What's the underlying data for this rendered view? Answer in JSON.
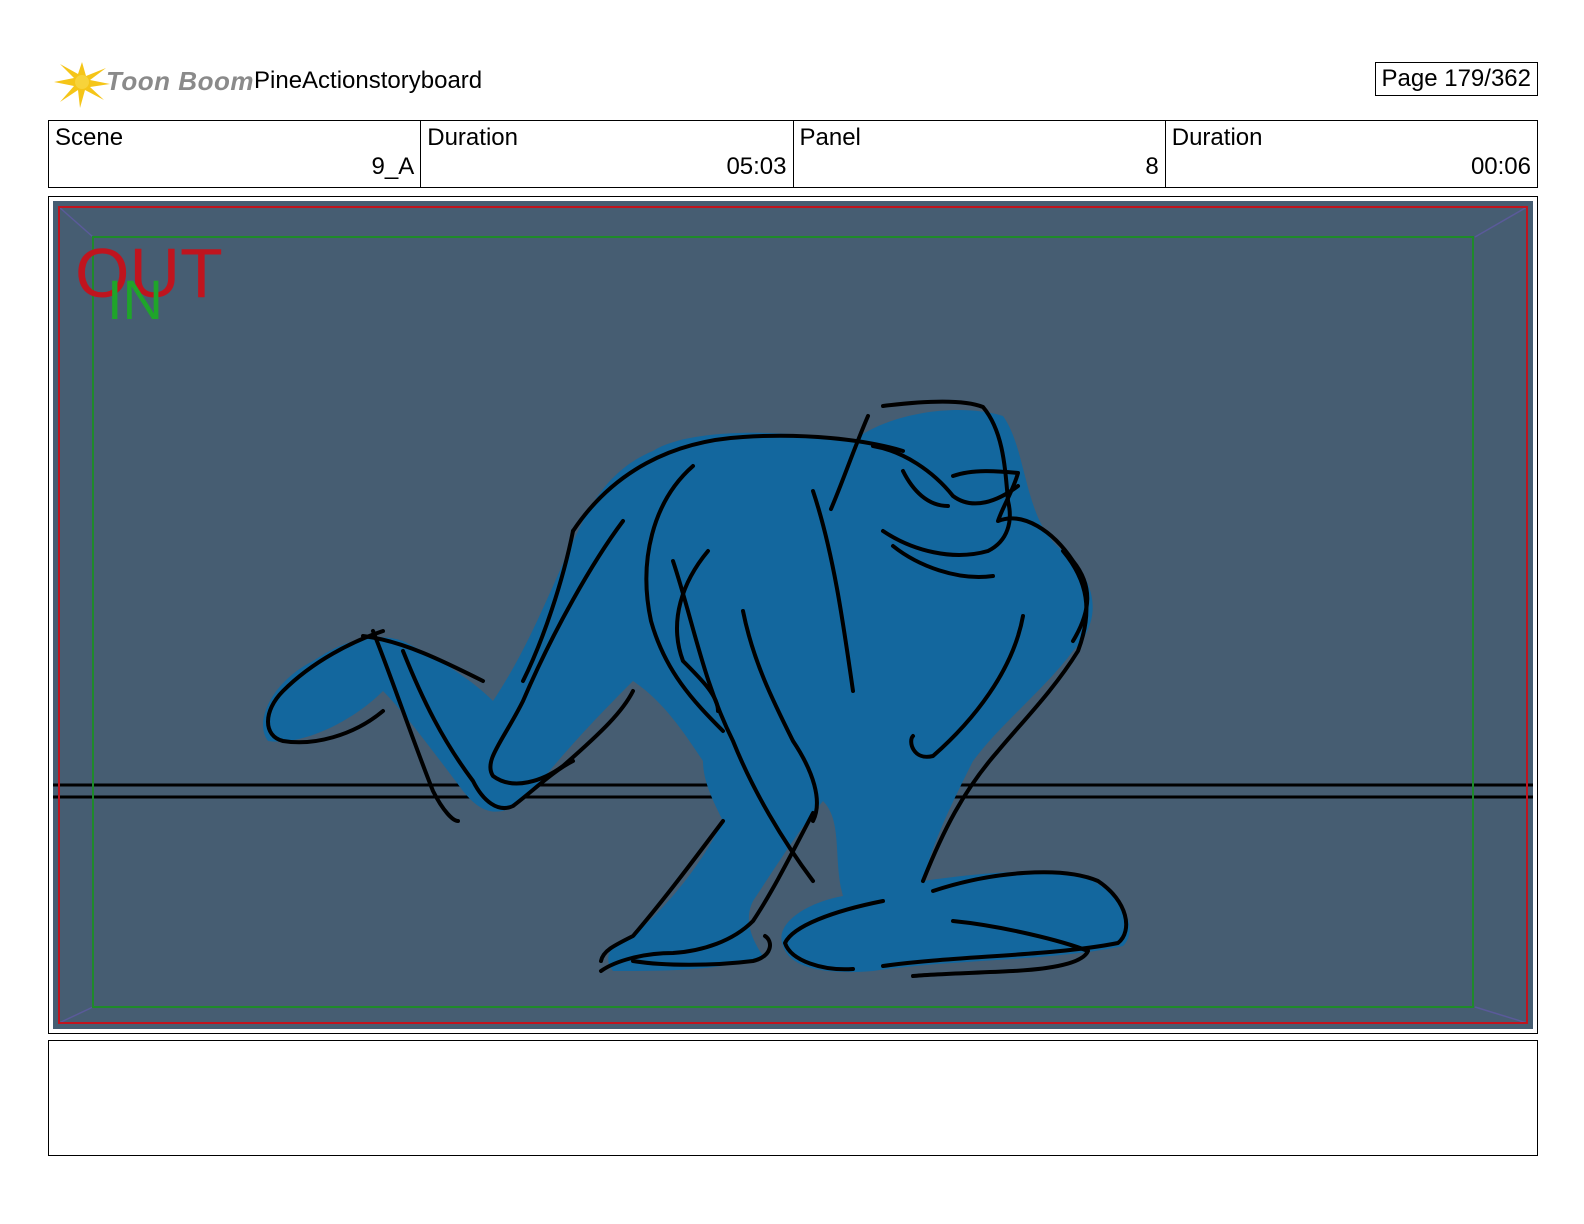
{
  "header": {
    "logo_text": "Toon Boom",
    "project_name": "PineActionstoryboard",
    "page_label": "Page 179/362"
  },
  "info": {
    "scene_label": "Scene",
    "scene_value": "9_A",
    "scene_duration_label": "Duration",
    "scene_duration_value": "05:03",
    "panel_label": "Panel",
    "panel_value": "8",
    "panel_duration_label": "Duration",
    "panel_duration_value": "00:06"
  },
  "panel": {
    "out_label": "OUT",
    "in_label": "IN",
    "background_color": "#465d72",
    "character_fill_color": "#13679e",
    "out_frame_color": "#c0141e",
    "in_frame_color": "#1f8a2a"
  },
  "notes": {
    "text": ""
  }
}
